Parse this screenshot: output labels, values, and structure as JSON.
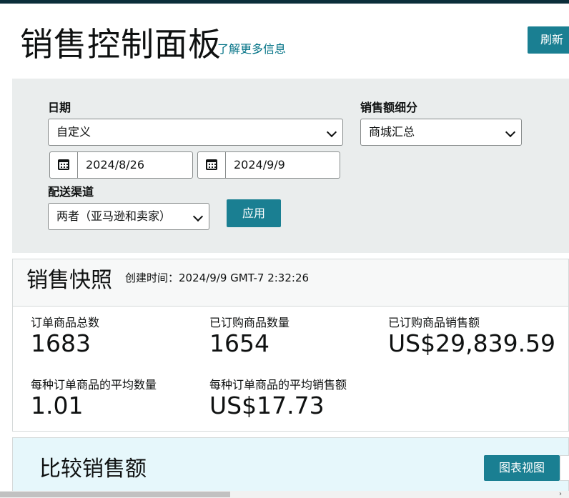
{
  "header": {
    "title": "销售控制面板",
    "learn_more": "了解更多信息",
    "refresh": "刷新"
  },
  "filters": {
    "date_label": "日期",
    "date_range_selected": "自定义",
    "start_date": "2024/8/26",
    "end_date": "2024/9/9",
    "breakdown_label": "销售额细分",
    "breakdown_selected": "商城汇总",
    "channel_label": "配送渠道",
    "channel_selected": "两者（亚马逊和卖家）",
    "apply": "应用"
  },
  "snapshot": {
    "title": "销售快照",
    "created": "创建时间：2024/9/9 GMT-7 2:32:26",
    "metrics": [
      {
        "label": "订单商品总数",
        "value": "1683"
      },
      {
        "label": "已订购商品数量",
        "value": "1654"
      },
      {
        "label": "已订购商品销售额",
        "value": "US$29,839.59"
      },
      {
        "label": "每种订单商品的平均数量",
        "value": "1.01"
      },
      {
        "label": "每种订单商品的平均销售额",
        "value": "US$17.73"
      }
    ]
  },
  "compare": {
    "title": "比较销售额",
    "chart_view": "图表视图"
  },
  "icons": {
    "calendar": "calendar-icon",
    "chevron": "chevron-down-icon"
  },
  "colors": {
    "accent": "#1a7f92",
    "link": "#007185",
    "filter_bg": "#eaeded",
    "compare_bg": "#e6f7fb"
  }
}
